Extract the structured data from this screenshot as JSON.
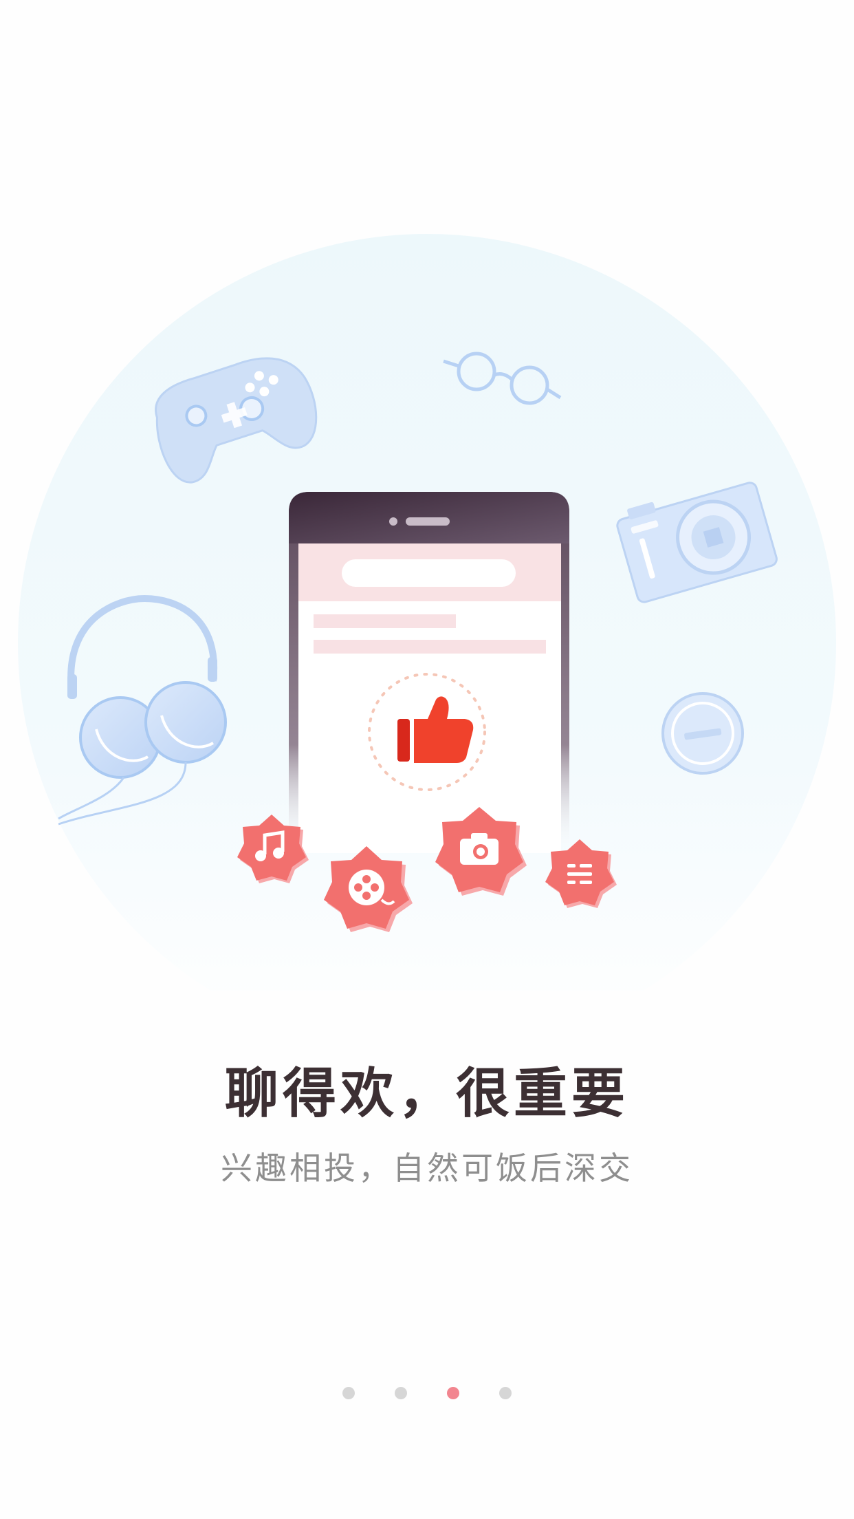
{
  "onboarding": {
    "title": "聊得欢，很重要",
    "subtitle": "兴趣相投，自然可饭后深交"
  },
  "pager": {
    "pages": 4,
    "active_index": 2
  },
  "colors": {
    "title": "#3c2f33",
    "subtitle": "#8e8e8e",
    "accent": "#f2858f",
    "badge": "#f2706e",
    "thumb": "#f0422c",
    "phone_frame": "#3f2d3a",
    "circle_bg": "#eef8fc",
    "line_art": "#a9c9f2"
  },
  "icons": [
    "game-controller-icon",
    "glasses-icon",
    "camera-icon",
    "headphones-icon",
    "coin-icon",
    "phone-icon",
    "thumbs-up-icon",
    "music-badge-icon",
    "film-reel-badge-icon",
    "camera-badge-icon",
    "menu-badge-icon"
  ]
}
